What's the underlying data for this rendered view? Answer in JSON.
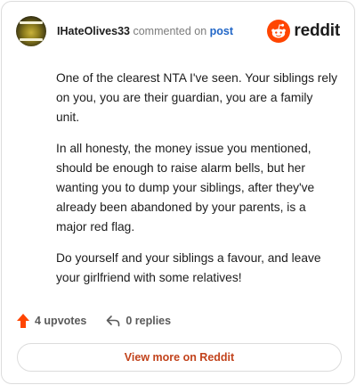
{
  "header": {
    "username": "IHateOlives33",
    "commented_text": "commented on",
    "post_link": "post",
    "logo_text": "reddit"
  },
  "comment": {
    "paragraphs": [
      "One of the clearest NTA I've seen. Your siblings rely on you, you are their guardian, you are a family unit.",
      "In all honesty, the money issue you mentioned, should be enough to raise alarm bells, but her wanting you to dump your siblings, after they've already been abandoned by your parents, is a major red flag.",
      "Do yourself and your siblings a favour, and leave your girlfriend with some relatives!"
    ]
  },
  "actions": {
    "upvotes_label": "4 upvotes",
    "replies_label": "0 replies"
  },
  "footer": {
    "view_more_label": "View more on Reddit"
  },
  "colors": {
    "upvote": "#ff4500",
    "link": "#2166c7",
    "view_more": "#c2431c"
  },
  "icons": [
    "avatar-image",
    "reddit-logo-icon",
    "upvote-arrow-icon",
    "reply-arrow-icon"
  ]
}
